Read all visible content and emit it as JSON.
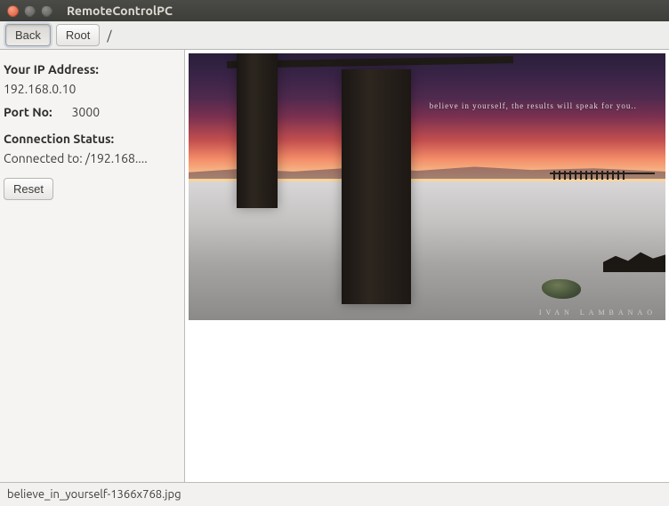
{
  "window": {
    "title": "RemoteControlPC"
  },
  "toolbar": {
    "back_label": "Back",
    "root_label": "Root",
    "path": "/"
  },
  "sidebar": {
    "ip_label": "Your IP Address:",
    "ip_value": "192.168.0.10",
    "port_label": "Port No:",
    "port_value": "3000",
    "status_label": "Connection Status:",
    "status_value": "Connected to: /192.168....",
    "reset_label": "Reset"
  },
  "image": {
    "quote_text": "believe in yourself, the results will speak for you..",
    "signature": "IVAN  LAMBANAO"
  },
  "statusbar": {
    "filename": "believe_in_yourself-1366x768.jpg"
  }
}
